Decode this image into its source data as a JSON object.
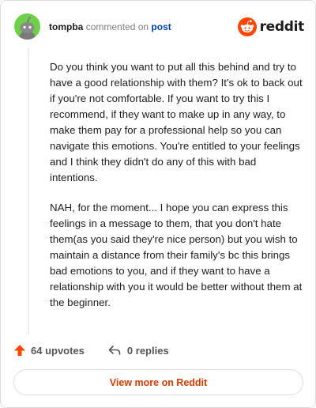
{
  "header": {
    "username": "tompba",
    "action_text": "commented on",
    "post_link": "post",
    "logo_text": "reddit"
  },
  "comment": {
    "paragraphs": [
      "Do you think you want to put all this behind and try to have a good relationship with them? It's ok to back out if you're not comfortable. If you want to try this I recommend, if they want to make up in any way, to make them pay for a professional help so you can navigate this emotions. You're entitled to your feelings and I think they didn't do any of this with bad intentions.",
      "NAH, for the moment... I hope you can express this feelings in a message to them, that you don't hate them(as you said they're nice person) but you wish to maintain a distance from their family's bc this brings bad emotions to you, and if they want to have a relationship with you it would be better without them at the beginner."
    ]
  },
  "footer": {
    "upvotes": "64 upvotes",
    "replies": "0 replies"
  },
  "view_more": "View more on Reddit",
  "colors": {
    "brand": "#ff4500",
    "link": "#0045ac",
    "avatar_bg": "#6fd04a",
    "button_text": "#d93a00"
  },
  "icons": [
    "snoo-avatar-icon",
    "reddit-logo-icon",
    "upvote-arrow-icon",
    "reply-arrow-icon"
  ]
}
